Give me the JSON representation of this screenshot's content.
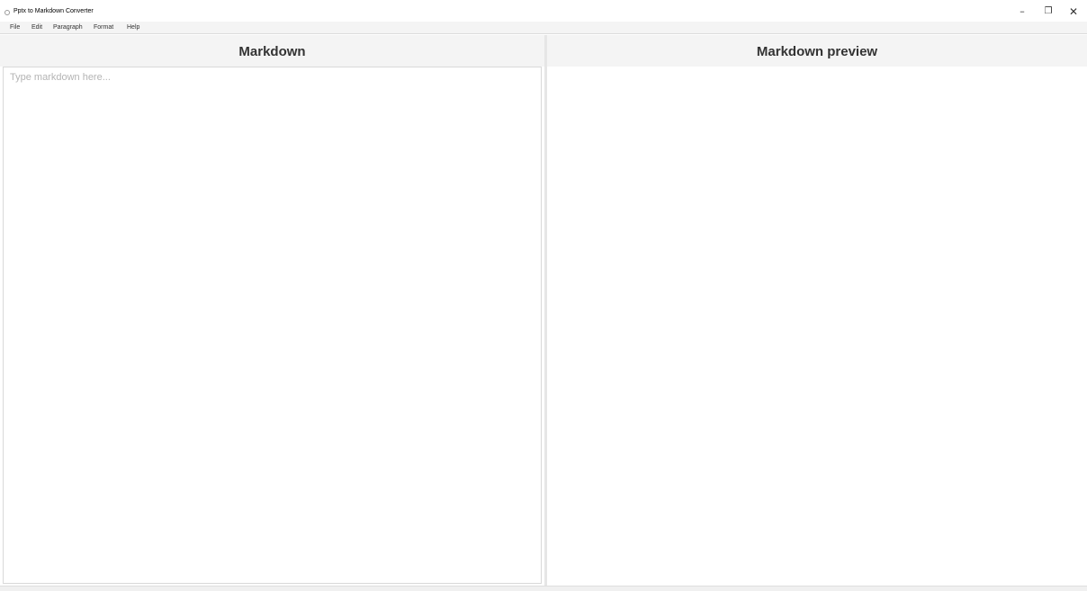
{
  "window": {
    "title": "Pptx to Markdown Converter",
    "controls": {
      "minimize": "–",
      "restore": "❐",
      "close": "✕"
    }
  },
  "menu": {
    "items": [
      {
        "label": "File"
      },
      {
        "label": "Edit"
      },
      {
        "label": "Paragraph"
      },
      {
        "label": "Format"
      },
      {
        "label": "Help"
      }
    ]
  },
  "editor": {
    "header": "Markdown",
    "value": "",
    "placeholder": "Type markdown here..."
  },
  "preview": {
    "header": "Markdown preview",
    "content": ""
  },
  "colors": {
    "header_bg": "#f4f4f4",
    "placeholder": "#b4b4b4",
    "text": "#333333"
  }
}
